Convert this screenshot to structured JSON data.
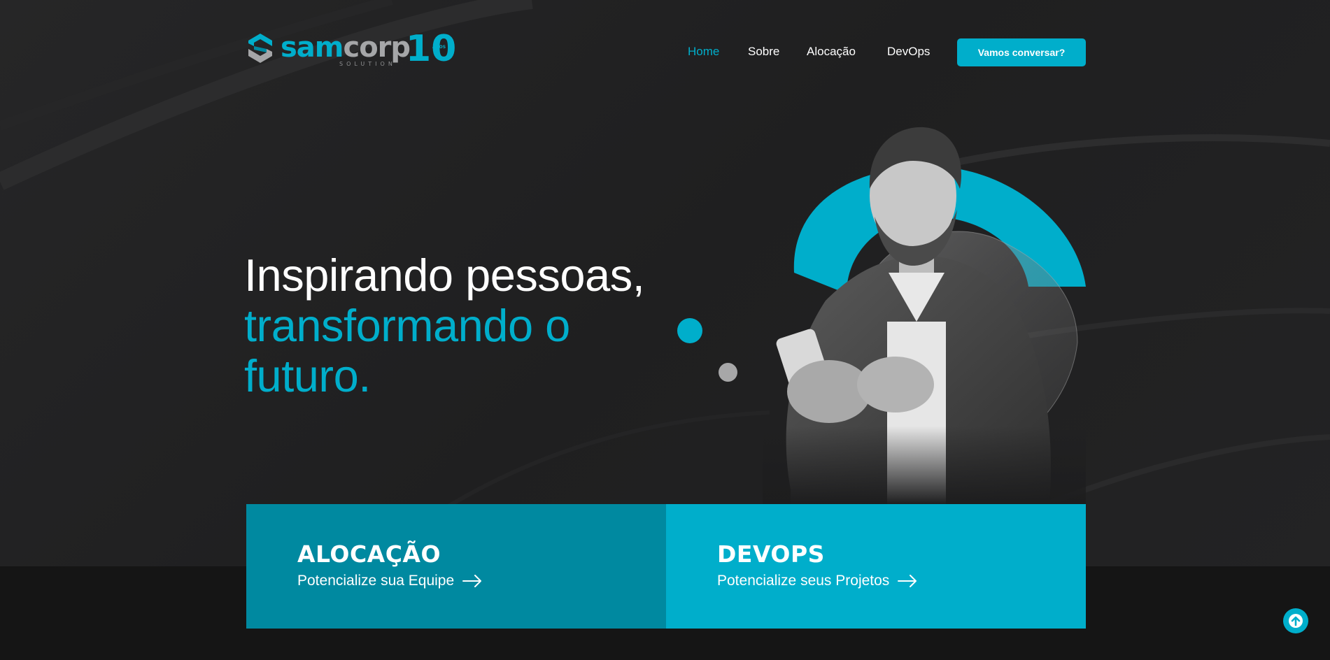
{
  "brand": {
    "word_sam": "sam",
    "word_corp": "corp",
    "sub": "SOLUTION",
    "ten": "10",
    "anos": "ANOS",
    "accent": "#00aecb",
    "secondary": "#a5a6a8"
  },
  "nav": {
    "items": [
      {
        "label": "Home",
        "active": true
      },
      {
        "label": "Sobre",
        "active": false
      },
      {
        "label": "Alocação",
        "active": false
      },
      {
        "label": "DevOps",
        "active": false
      }
    ],
    "cta_label": "Vamos conversar?"
  },
  "hero": {
    "line1": "Inspirando pessoas,",
    "line2": "transformando o",
    "line3": "futuro."
  },
  "cards": [
    {
      "title": "ALOCAÇÃO",
      "subtitle": "Potencialize sua Equipe",
      "icon": "arrow-right-icon",
      "color": "#0089a0"
    },
    {
      "title": "DEVOPS",
      "subtitle": "Potencialize seus Projetos",
      "icon": "arrow-right-icon",
      "color": "#00aecb"
    }
  ],
  "scroll_top": {
    "icon": "arrow-up-icon"
  }
}
